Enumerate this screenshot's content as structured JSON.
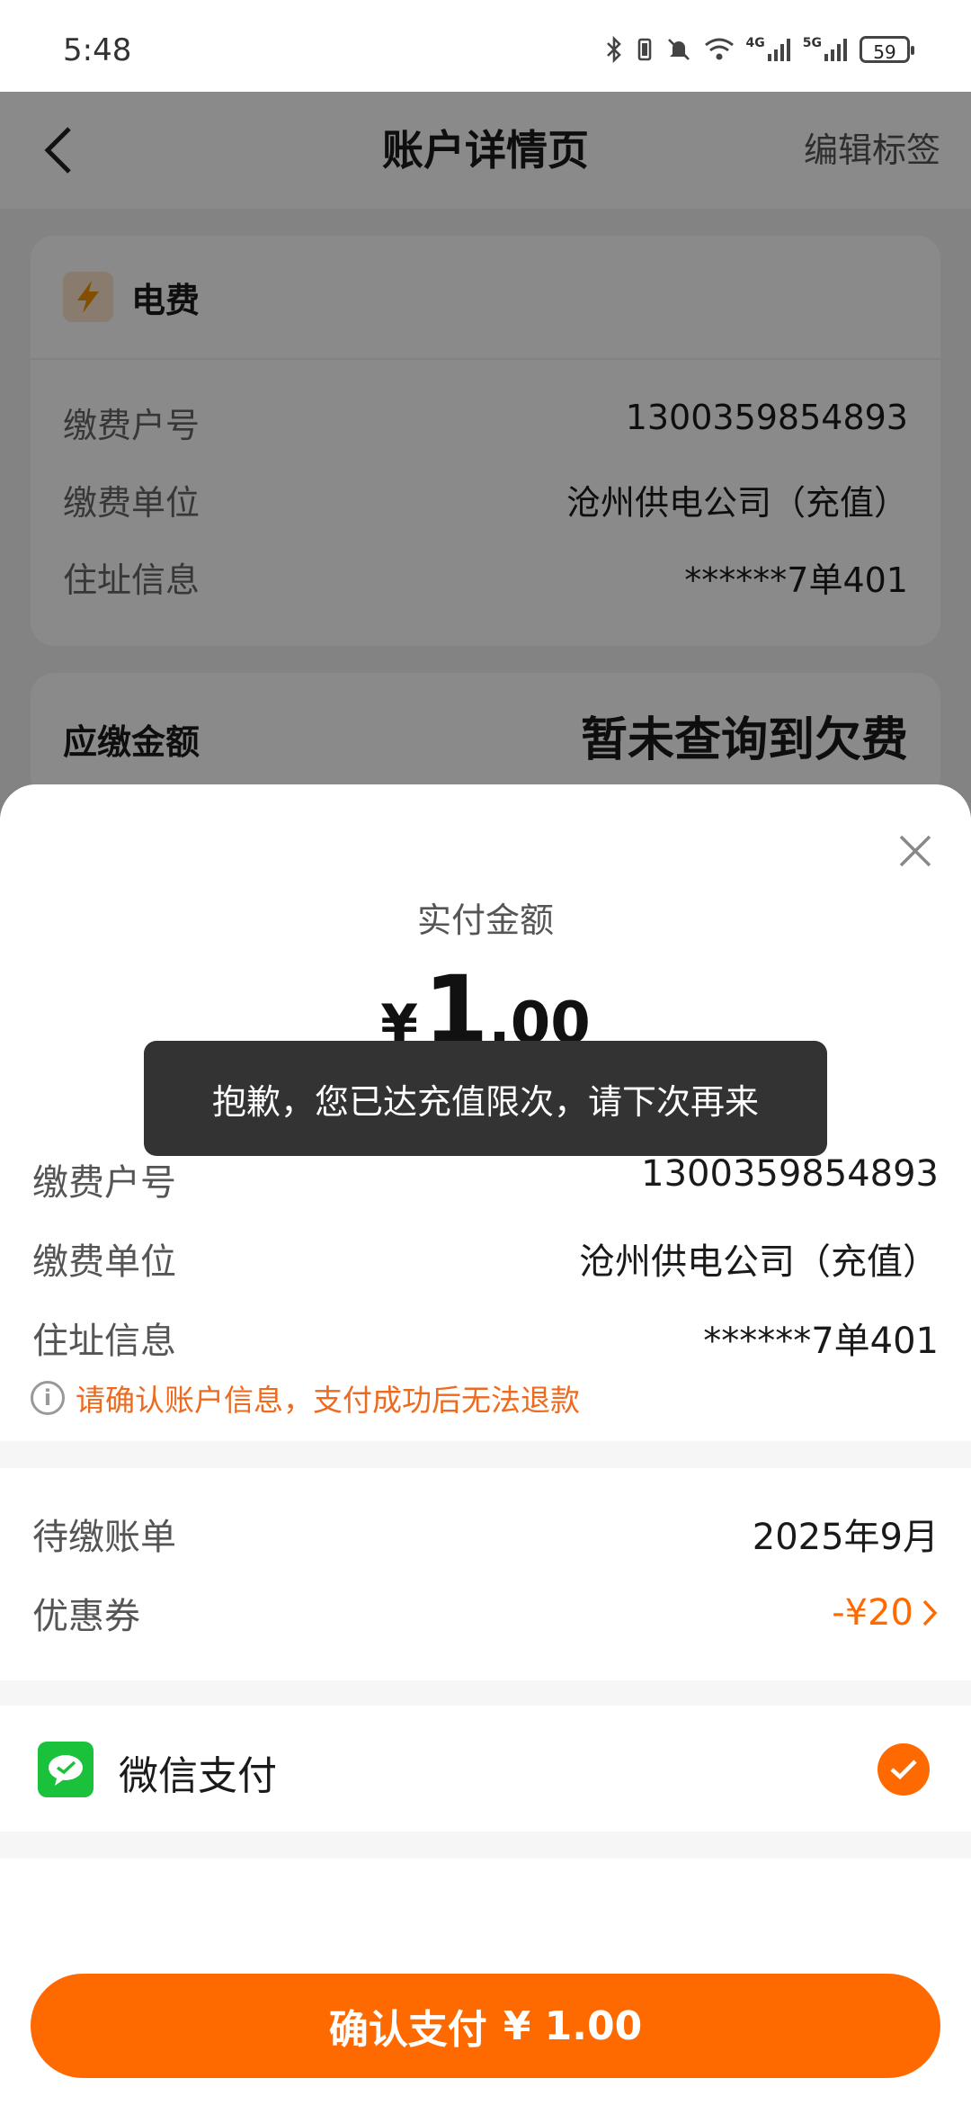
{
  "status_bar": {
    "time": "5:48",
    "battery": "59",
    "net1": "4G",
    "net2": "5G"
  },
  "header": {
    "title": "账户详情页",
    "edit_label": "编辑标签"
  },
  "account_card": {
    "type_label": "电费",
    "rows": [
      {
        "label": "缴费户号",
        "value": "1300359854893"
      },
      {
        "label": "缴费单位",
        "value": "沧州供电公司（充值）"
      },
      {
        "label": "住址信息",
        "value": "******7单401"
      }
    ]
  },
  "due_card": {
    "label": "应缴金额",
    "value": "暂未查询到欠费"
  },
  "sheet": {
    "pay_label": "实付金额",
    "currency": "¥",
    "amount_int": "1",
    "amount_dec": ".00",
    "toast": "抱歉，您已达充值限次，请下次再来",
    "rows": [
      {
        "label": "缴费户号",
        "value": "1300359854893"
      },
      {
        "label": "缴费单位",
        "value": "沧州供电公司（充值）"
      },
      {
        "label": "住址信息",
        "value": "******7单401"
      }
    ],
    "warning": "请确认账户信息，支付成功后无法退款",
    "bill_label": "待缴账单",
    "bill_value": "2025年9月",
    "coupon_label": "优惠券",
    "coupon_value": "-¥20",
    "pay_method": "微信支付",
    "confirm_label": "确认支付",
    "confirm_amount": "¥ 1.00"
  },
  "colors": {
    "accent": "#ff6a00",
    "warning_text": "#ee6a1f",
    "wechat_green": "#19c23a",
    "toast_bg": "#333333"
  }
}
